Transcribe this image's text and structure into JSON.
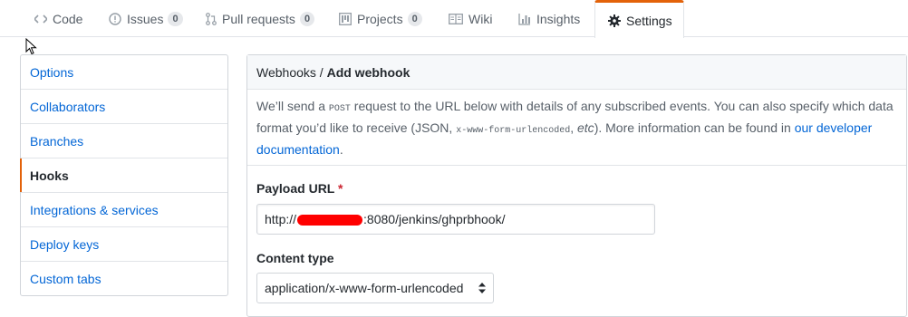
{
  "nav": {
    "tabs": [
      {
        "label": "Code",
        "icon": "code-icon"
      },
      {
        "label": "Issues",
        "icon": "issue-opened-icon",
        "count": "0"
      },
      {
        "label": "Pull requests",
        "icon": "git-pull-request-icon",
        "count": "0"
      },
      {
        "label": "Projects",
        "icon": "project-icon",
        "count": "0"
      },
      {
        "label": "Wiki",
        "icon": "book-icon"
      },
      {
        "label": "Insights",
        "icon": "graph-icon"
      },
      {
        "label": "Settings",
        "icon": "gear-icon",
        "selected": true
      }
    ]
  },
  "menu": {
    "items": [
      {
        "label": "Options"
      },
      {
        "label": "Collaborators"
      },
      {
        "label": "Branches"
      },
      {
        "label": "Hooks",
        "selected": true
      },
      {
        "label": "Integrations & services"
      },
      {
        "label": "Deploy keys"
      },
      {
        "label": "Custom tabs"
      }
    ]
  },
  "panel": {
    "breadcrumb": "Webhooks",
    "separator": " / ",
    "title": "Add webhook",
    "intro": {
      "p1": "We’ll send a ",
      "code1": "POST",
      "p2": " request to the URL below with details of any subscribed events. You can also specify which data format you’d like to receive (JSON, ",
      "code2": "x-www-form-urlencoded",
      "p3": ", ",
      "etc": "etc",
      "p4": "). More information can be found in ",
      "link": "our developer documentation",
      "p5": "."
    },
    "payload_url": {
      "label": "Payload URL",
      "required_mark": "*",
      "value_prefix": "http://",
      "value_suffix": ":8080/jenkins/ghprbhook/"
    },
    "content_type": {
      "label": "Content type",
      "selected": "application/x-www-form-urlencoded"
    }
  },
  "colors": {
    "accent": "#e36209",
    "link": "#0366d6",
    "redaction": "#ff0000"
  }
}
